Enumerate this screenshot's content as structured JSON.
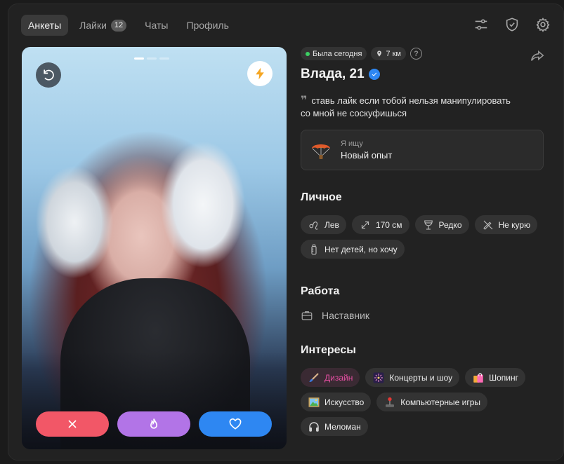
{
  "nav": {
    "tabs": [
      {
        "label": "Анкеты",
        "active": true
      },
      {
        "label": "Лайки",
        "badge": "12"
      },
      {
        "label": "Чаты"
      },
      {
        "label": "Профиль"
      }
    ],
    "icons": [
      "filters-icon",
      "shield-check-icon",
      "settings-gear-icon"
    ]
  },
  "photo": {
    "slides_total": 3,
    "slide_active": 1,
    "icons": {
      "undo": "undo-arrow-icon",
      "boost": "lightning-icon"
    },
    "actions": [
      {
        "name": "dislike",
        "icon": "close-x-icon",
        "color": "#f25767"
      },
      {
        "name": "super",
        "icon": "flame-icon",
        "color": "#b274e7"
      },
      {
        "name": "like",
        "icon": "heart-icon",
        "color": "#2e87f2"
      }
    ]
  },
  "profile": {
    "status": "Была сегодня",
    "status_color": "#3ccf63",
    "distance": "7 км",
    "help": "?",
    "name": "Влада, 21",
    "verified": true,
    "bio_line1": "ставь лайк если тобой нельзя манипулировать",
    "bio_line2": "со мной не соскуфишься",
    "seeking_label": "Я ищу",
    "seeking_value": "Новый опыт"
  },
  "personal": {
    "title": "Личное",
    "chips": [
      {
        "label": "Лев",
        "icon": "leo-zodiac-icon"
      },
      {
        "label": "170 см",
        "icon": "height-arrows-icon"
      },
      {
        "label": "Редко",
        "icon": "wine-glass-icon"
      },
      {
        "label": "Не курю",
        "icon": "no-smoking-icon"
      },
      {
        "label": "Нет детей, но хочу",
        "icon": "baby-bottle-icon"
      }
    ]
  },
  "work": {
    "title": "Работа",
    "value": "Наставник",
    "icon": "briefcase-icon"
  },
  "interests": {
    "title": "Интересы",
    "accent_color": "#e64fa3",
    "chips": [
      {
        "label": "Дизайн",
        "icon": "brush-icon",
        "highlighted": true
      },
      {
        "label": "Концерты и шоу",
        "icon": "sparkler-icon"
      },
      {
        "label": "Шопинг",
        "icon": "shopping-bags-icon"
      },
      {
        "label": "Искусство",
        "icon": "framed-picture-icon"
      },
      {
        "label": "Компьютерные игры",
        "icon": "joystick-icon"
      },
      {
        "label": "Меломан",
        "icon": "headphones-icon"
      }
    ]
  }
}
